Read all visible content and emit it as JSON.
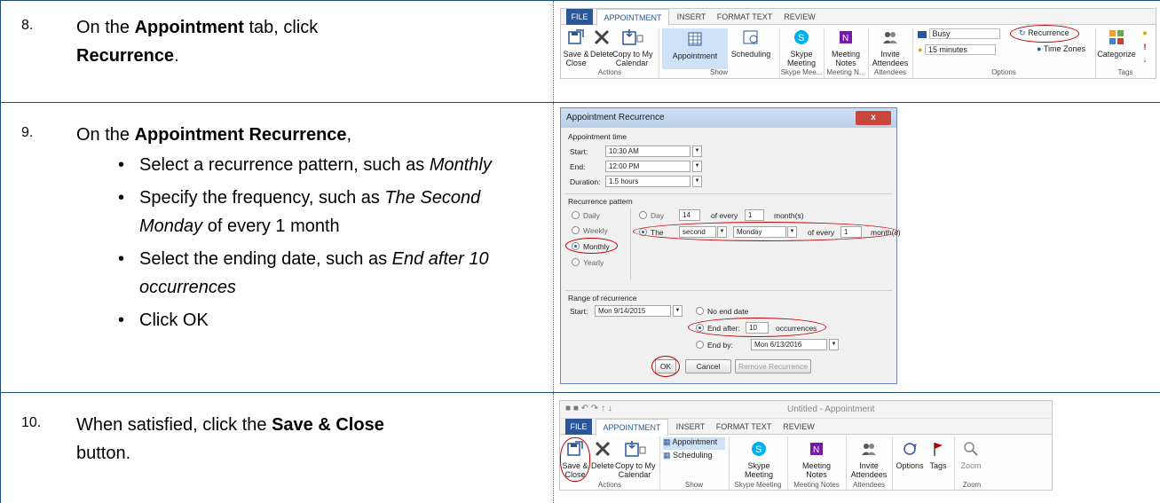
{
  "step8": {
    "number": "8.",
    "pre": "On the ",
    "bold1": "Appointment",
    "mid": " tab, click",
    "bold2": "Recurrence",
    "post": "."
  },
  "step9": {
    "number": "9.",
    "pre": "On the ",
    "bold": "Appointment Recurrence",
    "post": ",",
    "bullets": {
      "b1_text": "Select a recurrence pattern, such as ",
      "b1_italic": "Monthly",
      "b2_text": "Specify the frequency, such as ",
      "b2_italic": "The Second Monday",
      "b2_post": " of every 1 month",
      "b3_text": "Select the ending date, such as ",
      "b3_italic": "End after 10 occurrences",
      "b4_text": "Click OK"
    }
  },
  "step10": {
    "number": "10.",
    "pre": "When satisfied, click the ",
    "bold": "Save & Close",
    "post": "button."
  },
  "ribbon1": {
    "tabs": [
      "FILE",
      "APPOINTMENT",
      "INSERT",
      "FORMAT TEXT",
      "REVIEW"
    ],
    "save_close": "Save &\nClose",
    "delete": "Delete",
    "copy_to_my_calendar": "Copy to My\nCalendar",
    "appointment": "Appointment",
    "scheduling": "Scheduling",
    "skype_meeting": "Skype\nMeeting",
    "meeting_notes": "Meeting\nNotes",
    "invite_attendees": "Invite\nAttendees",
    "busy": "Busy",
    "reminder": "15 minutes",
    "recurrence": "Recurrence",
    "time_zones": "Time Zones",
    "categorize": "Categorize",
    "groups": [
      "Actions",
      "Show",
      "Skype Mee...",
      "Meeting N...",
      "Attendees",
      "Options",
      "Tags"
    ]
  },
  "dialog": {
    "title": "Appointment Recurrence",
    "close": "x",
    "appointment_time": "Appointment time",
    "start_label": "Start:",
    "start_value": "10:30 AM",
    "end_label": "End:",
    "end_value": "12:00 PM",
    "duration_label": "Duration:",
    "duration_value": "1.5 hours",
    "recurrence_pattern": "Recurrence pattern",
    "daily": "Daily",
    "weekly": "Weekly",
    "monthly": "Monthly",
    "yearly": "Yearly",
    "day_label": "Day",
    "day_value": "14",
    "of_every": "of every",
    "every_value_1": "1",
    "months_1": "month(s)",
    "the_label": "The",
    "ordinal": "second",
    "weekday": "Monday",
    "of_every_2": "of every",
    "every_value_2": "1",
    "months_2": "month(s)",
    "range_of_recurrence": "Range of recurrence",
    "range_start_label": "Start:",
    "range_start_value": "Mon 9/14/2015",
    "no_end_date": "No end date",
    "end_after": "End after:",
    "end_after_value": "10",
    "occurrences": "occurrences",
    "end_by": "End by:",
    "end_by_value": "Mon 6/13/2016",
    "ok": "OK",
    "cancel": "Cancel",
    "remove_recurrence": "Remove Recurrence"
  },
  "ribbon3": {
    "window_title": "Untitled - Appointment",
    "tabs": [
      "FILE",
      "APPOINTMENT",
      "INSERT",
      "FORMAT TEXT",
      "REVIEW"
    ],
    "save_close": "Save &\nClose",
    "delete": "Delete",
    "copy_to_my_calendar": "Copy to My\nCalendar",
    "appointment": "Appointment",
    "scheduling": "Scheduling",
    "skype_meeting": "Skype\nMeeting",
    "meeting_notes": "Meeting\nNotes",
    "invite_attendees": "Invite\nAttendees",
    "options": "Options",
    "tags": "Tags",
    "zoom": "Zoom",
    "groups": [
      "Actions",
      "Show",
      "Skype Meeting",
      "Meeting Notes",
      "Attendees",
      "Zoom"
    ]
  },
  "colors": {
    "file_tab": "#2b579a",
    "highlight_circle": "#c00000",
    "table_border": "#1f4e79"
  }
}
